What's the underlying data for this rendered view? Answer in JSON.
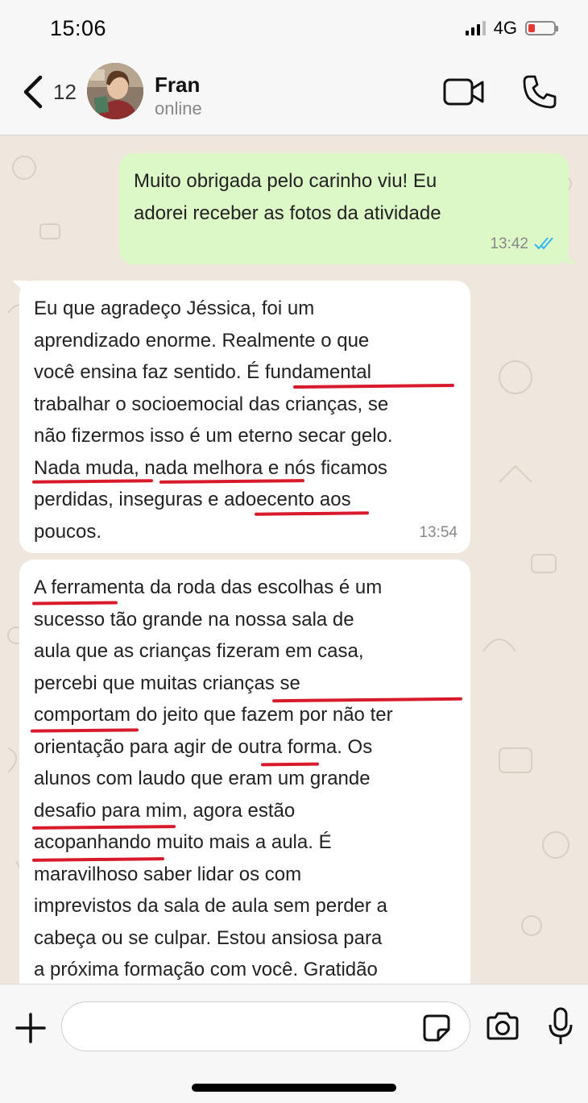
{
  "status_bar": {
    "time": "15:06",
    "network": "4G",
    "battery_level": 0.25
  },
  "header": {
    "back_count": "12",
    "contact_name": "Fran",
    "contact_status": "online"
  },
  "messages": [
    {
      "direction": "outgoing",
      "lines": [
        "Muito obrigada pelo carinho viu! Eu",
        "adorei receber as fotos da atividade"
      ],
      "time": "13:42",
      "status": "read"
    },
    {
      "direction": "incoming",
      "lines": [
        "Eu que agradeço Jéssica, foi um",
        "aprendizado enorme. Realmente o que",
        "você ensina faz sentido. É fundamental",
        "trabalhar o socioemocial das crianças, se",
        "não fizermos isso é um eterno secar gelo.",
        "Nada muda, nada melhora e nós ficamos",
        "perdidas, inseguras e adoecento aos",
        "poucos."
      ],
      "time": "13:54"
    },
    {
      "direction": "incoming",
      "lines": [
        "A ferramenta da roda das escolhas é um",
        "sucesso tão grande na nossa sala de",
        "aula que as crianças fizeram em casa,",
        "percebi que muitas crianças se",
        "comportam do jeito que fazem por não ter",
        "orientação para agir de outra forma. Os",
        "alunos com laudo que eram um grande",
        "desafio para mim, agora estão",
        "acopanhando muito mais a aula. É",
        "maravilhoso saber lidar os com",
        "imprevistos da sala de aula sem perder a",
        "cabeça ou se culpar. Estou ansiosa para",
        "a próxima formação com você. Gratidão"
      ]
    }
  ],
  "input": {
    "placeholder": ""
  },
  "colors": {
    "outgoing_bubble": "#dcf8c6",
    "incoming_bubble": "#ffffff",
    "chat_bg": "#efe7dd",
    "read_ticks": "#34b7f1",
    "annotation_red": "#d81b2c"
  },
  "icons": [
    "back-chevron-icon",
    "video-call-icon",
    "phone-icon",
    "plus-icon",
    "sticker-icon",
    "camera-icon",
    "microphone-icon",
    "read-ticks-icon"
  ]
}
